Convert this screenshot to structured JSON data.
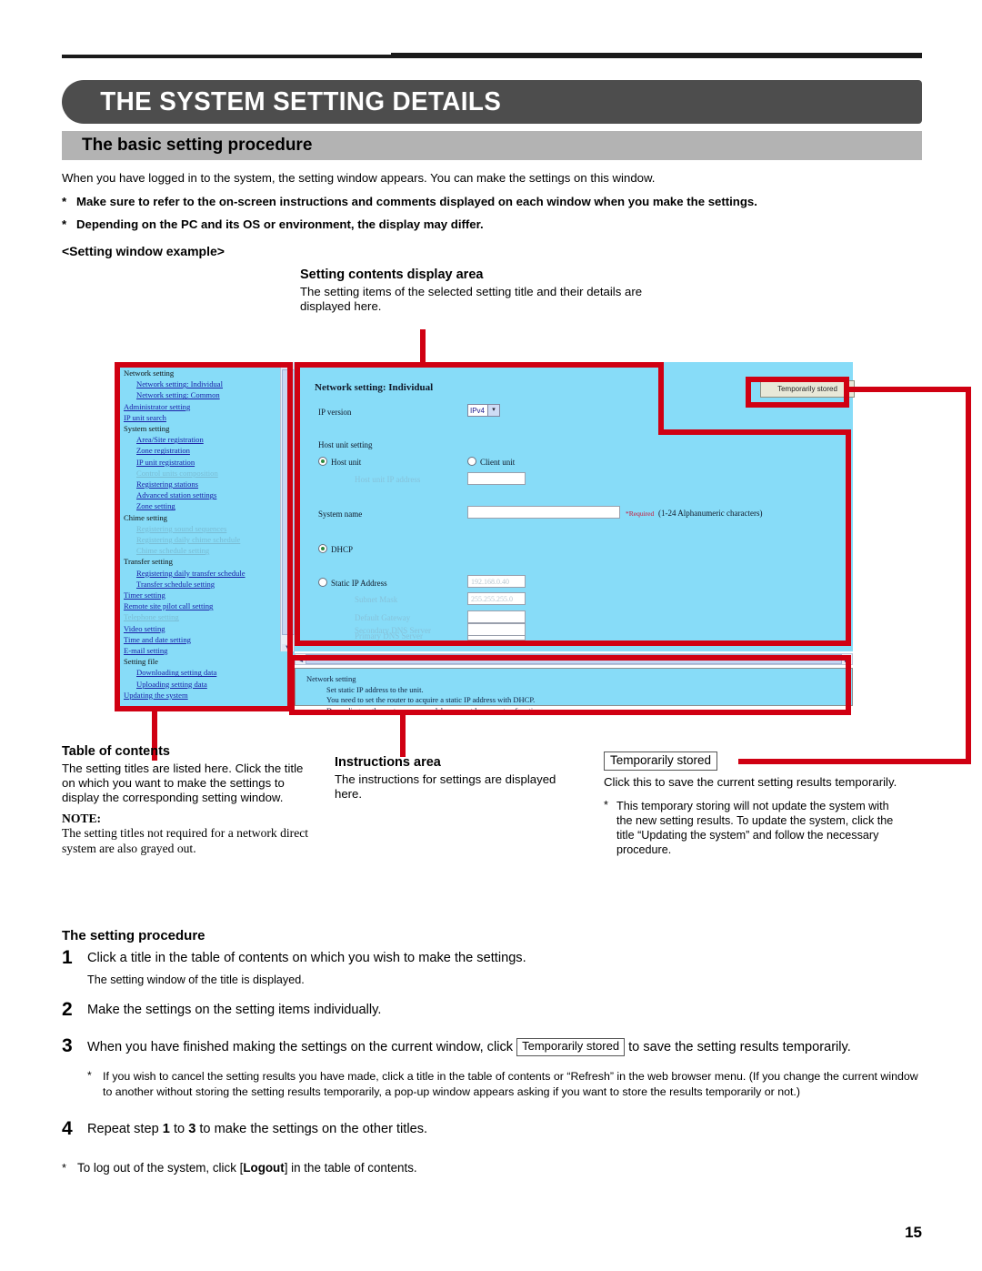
{
  "chapter": {
    "title": "THE SYSTEM SETTING DETAILS"
  },
  "section": {
    "title": "The basic setting procedure"
  },
  "intro": {
    "lead": "When you have logged in to the system, the setting window appears. You can make the settings on this window.",
    "star": "*",
    "note1": "Make sure to refer to the on-screen instructions and comments displayed on each window when you make the settings.",
    "note2": "Depending on the PC and its OS or environment, the display may differ."
  },
  "example_label": "<Setting window example>",
  "callouts": {
    "setting_contents": {
      "title": "Setting contents display area",
      "body": "The setting items of the selected setting title and their details are displayed here."
    },
    "table_of_contents": {
      "title": "Table of contents",
      "body": "The setting titles are listed here. Click the title on which you want to make the settings to display the corresponding setting window.",
      "note_label": "NOTE:",
      "note_body": "The setting titles not required for a network direct system are also grayed out."
    },
    "instructions_area": {
      "title": "Instructions area",
      "body": "The instructions for settings are displayed here."
    },
    "temporarily_stored": {
      "button_label": "Temporarily stored",
      "body": "Click this to save the current setting results temporarily.",
      "star": "*",
      "note": "This temporary storing will not update the system with the new setting results. To update the system, click the title “Updating the system” and follow the necessary procedure."
    }
  },
  "screenshot": {
    "toc": [
      {
        "label": "Network setting",
        "type": "group",
        "indent": false
      },
      {
        "label": "Network setting: Individual",
        "type": "link",
        "indent": true
      },
      {
        "label": "Network setting: Common",
        "type": "link",
        "indent": true
      },
      {
        "label": "Administrator setting",
        "type": "link",
        "indent": false
      },
      {
        "label": "IP unit search",
        "type": "link",
        "indent": false
      },
      {
        "label": "System setting",
        "type": "group",
        "indent": false
      },
      {
        "label": "Area/Site registration",
        "type": "link",
        "indent": true
      },
      {
        "label": "Zone registration",
        "type": "link",
        "indent": true
      },
      {
        "label": "IP unit registration",
        "type": "link",
        "indent": true
      },
      {
        "label": "Control units composition",
        "type": "disabled",
        "indent": true
      },
      {
        "label": "Registering stations",
        "type": "link",
        "indent": true
      },
      {
        "label": "Advanced station settings",
        "type": "link",
        "indent": true
      },
      {
        "label": "Zone setting",
        "type": "link",
        "indent": true
      },
      {
        "label": "Chime setting",
        "type": "group",
        "indent": false
      },
      {
        "label": "Registering sound sequences",
        "type": "disabled",
        "indent": true
      },
      {
        "label": "Registering daily chime schedule",
        "type": "disabled",
        "indent": true
      },
      {
        "label": "Chime schedule setting",
        "type": "disabled",
        "indent": true
      },
      {
        "label": "Transfer setting",
        "type": "group",
        "indent": false
      },
      {
        "label": "Registering daily transfer schedule",
        "type": "link",
        "indent": true
      },
      {
        "label": "Transfer schedule setting",
        "type": "link",
        "indent": true
      },
      {
        "label": "Timer setting",
        "type": "link",
        "indent": false
      },
      {
        "label": "Remote site pilot call setting",
        "type": "link",
        "indent": false
      },
      {
        "label": "Telephone setting",
        "type": "disabled",
        "indent": false
      },
      {
        "label": "Video setting",
        "type": "link",
        "indent": false
      },
      {
        "label": "Time and date setting",
        "type": "link",
        "indent": false
      },
      {
        "label": "E-mail setting",
        "type": "link",
        "indent": false
      },
      {
        "label": "Setting file",
        "type": "group",
        "indent": false
      },
      {
        "label": "Downloading setting data",
        "type": "link",
        "indent": true
      },
      {
        "label": "Uploading setting data",
        "type": "link",
        "indent": true
      },
      {
        "label": "Updating the system",
        "type": "link",
        "indent": false
      }
    ],
    "main": {
      "title": "Network setting: Individual",
      "ip_version_label": "IP version",
      "ip_version_value": "IPv4",
      "host_unit_setting_label": "Host unit setting",
      "host_unit_label": "Host unit",
      "client_unit_label": "Client unit",
      "host_unit_ip_label": "Host unit IP address",
      "host_unit_ip_value": "",
      "system_name_label": "System name",
      "system_name_value": "",
      "required_mark": "*Required",
      "required_hint": "(1-24 Alphanumeric characters)",
      "dhcp_label": "DHCP",
      "static_ip_label": "Static IP Address",
      "static_ip_value": "192.168.0.40",
      "subnet_mask_label": "Subnet Mask",
      "subnet_mask_value": "255.255.255.0",
      "default_gateway_label": "Default Gateway",
      "default_gateway_value": "",
      "primary_dns_label": "Primary DNS Server",
      "primary_dns_value": "",
      "secondary_dns_label": "Secondary DNS Server",
      "secondary_dns_value": "",
      "temporarily_stored_button": "Temporarily stored"
    },
    "instructions": {
      "heading": "Network setting",
      "line1": "Set static IP address to the unit.",
      "line2": "You need to set the router to acquire a static IP address with DHCP.",
      "line3": "Depending on the router, some models may not have a setup function."
    }
  },
  "procedure": {
    "heading": "The setting procedure",
    "steps": [
      {
        "num": "1",
        "text": "Click a title in the table of contents on which you wish to make the settings.",
        "sub": "The setting window of the title is displayed."
      },
      {
        "num": "2",
        "text": "Make the settings on the setting items individually.",
        "sub": ""
      }
    ],
    "step3": {
      "num": "3",
      "text_before": "When you have finished making the settings on the current window, click",
      "button": "Temporarily stored",
      "text_after": "to save the setting results temporarily."
    },
    "step3_note_star": "*",
    "step3_note": "If you wish to cancel the setting results you have made, click a title in the table of contents or “Refresh” in the web browser menu. (If you change the current window to another without storing the setting results temporarily, a pop-up window appears asking if you want to store the results temporarily or not.)",
    "step4": {
      "num": "4",
      "text_before": "Repeat step",
      "ref1": "1",
      "text_mid": "to",
      "ref2": "3",
      "text_after": "to make the settings on the other titles."
    },
    "final_star": "*",
    "final_before": "To log out of the system, click [",
    "final_bold": "Logout",
    "final_after": "] in the table of contents."
  },
  "page_number": "15",
  "colors": {
    "banner": "#4d4d4d",
    "section_bar": "#b3b3b3",
    "screen_blue": "#87dcf8",
    "callout_red": "#d00012",
    "link_blue": "#1b21a8",
    "disabled_link": "#79bcd4",
    "required_red": "#cc1133"
  }
}
